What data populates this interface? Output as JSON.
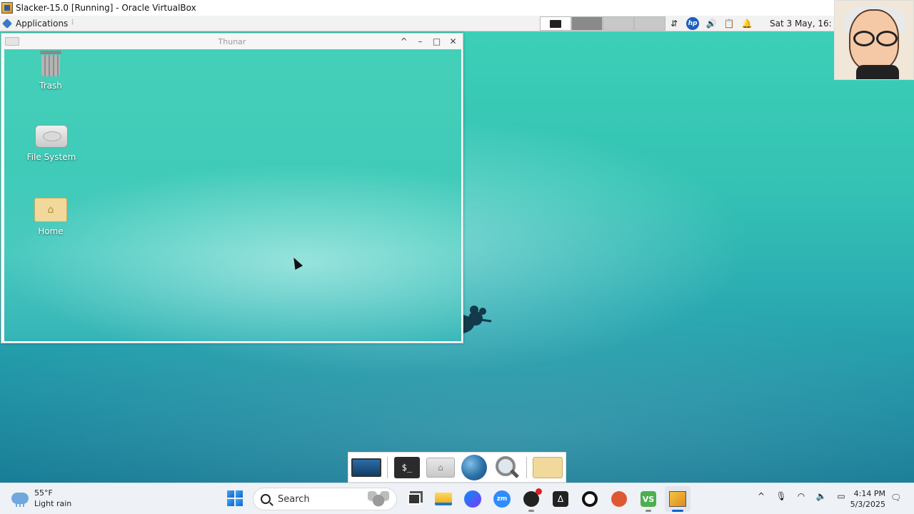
{
  "vbox": {
    "title": "Slacker-15.0 [Running] - Oracle VirtualBox"
  },
  "panel": {
    "apps_label": "Applications",
    "apps_sep": "⠇",
    "clock": "Sat  3 May, 16:",
    "workspaces": [
      "active",
      "dark",
      "light",
      "light"
    ]
  },
  "thunar": {
    "title": "Thunar",
    "buttons": {
      "shade": "^",
      "minimize": "–",
      "maximize": "□",
      "close": "✕"
    }
  },
  "desktop_icons": [
    {
      "label": "Trash",
      "icon": "trash-icon"
    },
    {
      "label": "File System",
      "icon": "drive-icon"
    },
    {
      "label": "Home",
      "icon": "home-folder-icon"
    }
  ],
  "dock": {
    "items": [
      "show-desktop-icon",
      "terminal-icon",
      "file-manager-icon",
      "web-browser-icon",
      "app-finder-icon",
      "folder-icon"
    ],
    "terminal_glyph": "$_"
  },
  "taskbar": {
    "weather_temp": "55°F",
    "weather_desc": "Light rain",
    "search_placeholder": "Search",
    "zoom_label": "zm",
    "delta_label": "Δ",
    "vs_label": "VS",
    "time": "4:14 PM",
    "date": "5/3/2025"
  },
  "colors": {
    "desktop_top": "#3ccfb6",
    "desktop_bottom": "#157b95",
    "windows_accent": "#0a64d0"
  }
}
